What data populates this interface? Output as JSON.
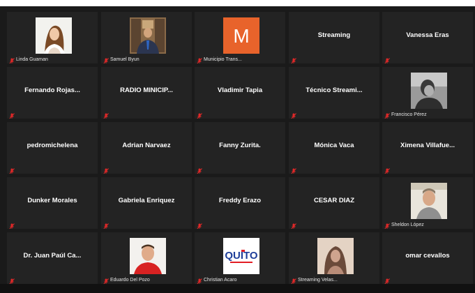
{
  "participants": [
    {
      "id": "p1",
      "label": "Linda Guaman",
      "video": "woman-portrait"
    },
    {
      "id": "p2",
      "label": "Samuel Byun",
      "video": "man-suit-portrait"
    },
    {
      "id": "p3",
      "label": "Municipio Trans...",
      "video": "orange-m-logo",
      "logo_text": "M"
    },
    {
      "id": "p4",
      "name": "Streaming"
    },
    {
      "id": "p5",
      "name": "Vanessa Eras"
    },
    {
      "id": "p6",
      "name": "Fernando  Rojas..."
    },
    {
      "id": "p7",
      "name": "RADIO MINICIP..."
    },
    {
      "id": "p8",
      "name": "Vladimir Tapia"
    },
    {
      "id": "p9",
      "name": "Técnico  Streami..."
    },
    {
      "id": "p10",
      "label": "Francisco Pérez",
      "video": "bw-portrait"
    },
    {
      "id": "p11",
      "name": "pedromichelena"
    },
    {
      "id": "p12",
      "name": "Adrian Narvaez"
    },
    {
      "id": "p13",
      "name": "Fanny Zurita."
    },
    {
      "id": "p14",
      "name": "Mónica Vaca"
    },
    {
      "id": "p15",
      "name": "Ximena  Villafue..."
    },
    {
      "id": "p16",
      "name": "Dunker Morales"
    },
    {
      "id": "p17",
      "name": "Gabriela Enriquez"
    },
    {
      "id": "p18",
      "name": "Freddy Erazo"
    },
    {
      "id": "p19",
      "name": "CESAR DIAZ"
    },
    {
      "id": "p20",
      "label": "Sheldon López",
      "video": "man-portrait"
    },
    {
      "id": "p21",
      "name": "Dr. Juan Paúl Ca..."
    },
    {
      "id": "p22",
      "label": "Eduardo Del Pozo",
      "video": "man-red-shirt"
    },
    {
      "id": "p23",
      "label": "Christian Acaro",
      "video": "quito-logo",
      "logo_text": "QUITO"
    },
    {
      "id": "p24",
      "label": "Streaming Velas...",
      "video": "woman-sepia"
    },
    {
      "id": "p25",
      "name": "omar cevallos"
    }
  ],
  "colors": {
    "tile_bg": "#232323",
    "background": "#1a1a1a",
    "muted_mic": "#e02828",
    "name_text": "#ffffff"
  },
  "icons": {
    "muted": "mic-muted-icon"
  }
}
